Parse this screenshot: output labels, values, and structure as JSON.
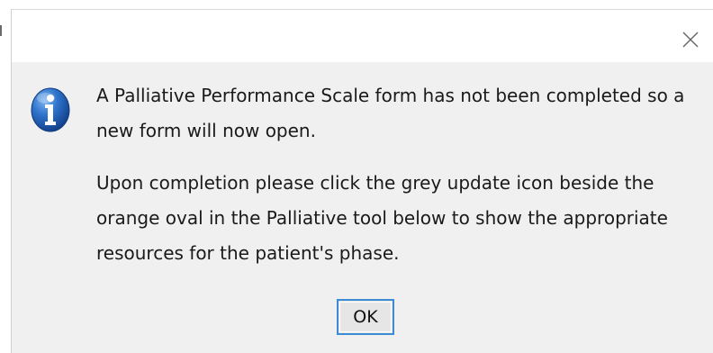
{
  "dialog": {
    "close_icon": "close-icon",
    "info_icon": "info-icon",
    "message_paragraph_1": "A Palliative Performance Scale form has not been completed so a new form will now open.",
    "message_paragraph_2": "Upon completion please click the grey update icon beside the orange oval in the Palliative tool below to show the appropriate resources for the patient's phase.",
    "ok_label": "OK"
  },
  "colors": {
    "dialog_background": "#f0f0f0",
    "titlebar_background": "#ffffff",
    "info_icon_blue": "#1f62b8",
    "ok_button_border": "#3c8bd3"
  }
}
